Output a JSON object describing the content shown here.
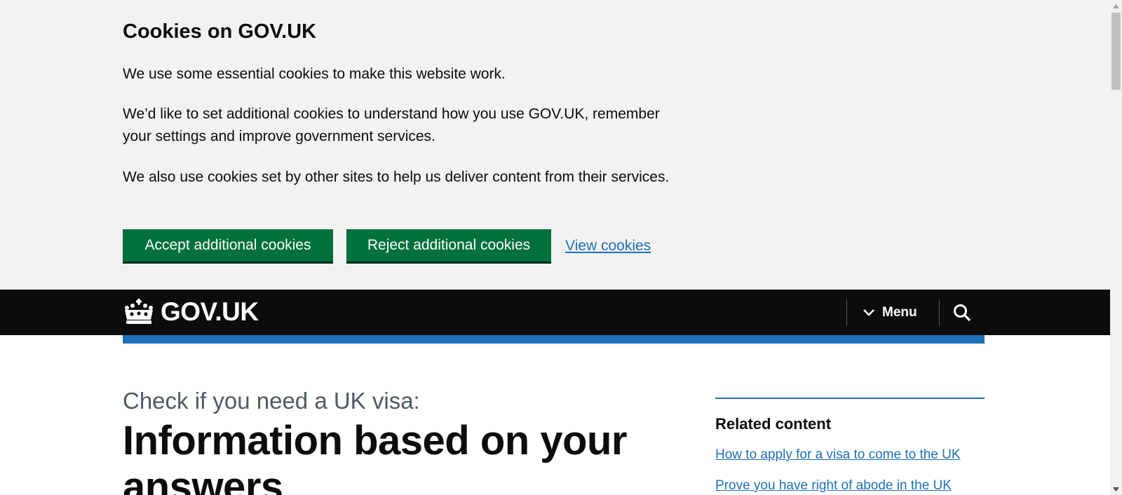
{
  "cookie_banner": {
    "title": "Cookies on GOV.UK",
    "paragraphs": [
      "We use some essential cookies to make this website work.",
      "We’d like to set additional cookies to understand how you use GOV.UK, remember your settings and improve government services.",
      "We also use cookies set by other sites to help us deliver content from their services."
    ],
    "accept_label": "Accept additional cookies",
    "reject_label": "Reject additional cookies",
    "view_label": "View cookies"
  },
  "header": {
    "logo_text": "GOV.UK",
    "logo_icon": "crown-icon",
    "menu_label": "Menu",
    "menu_icon": "chevron-down-icon",
    "search_icon": "search-icon"
  },
  "main": {
    "caption": "Check if you need a UK visa:",
    "title": "Information based on your answers"
  },
  "related": {
    "title": "Related content",
    "links": [
      "How to apply for a visa to come to the UK",
      "Prove you have right of abode in the UK"
    ]
  },
  "colors": {
    "banner_bg": "#f3f2f1",
    "header_bg": "#0b0c0c",
    "brand_blue": "#1d70b8",
    "button_green": "#00703c",
    "link": "#1d70b8",
    "caption_grey": "#505a5f"
  }
}
